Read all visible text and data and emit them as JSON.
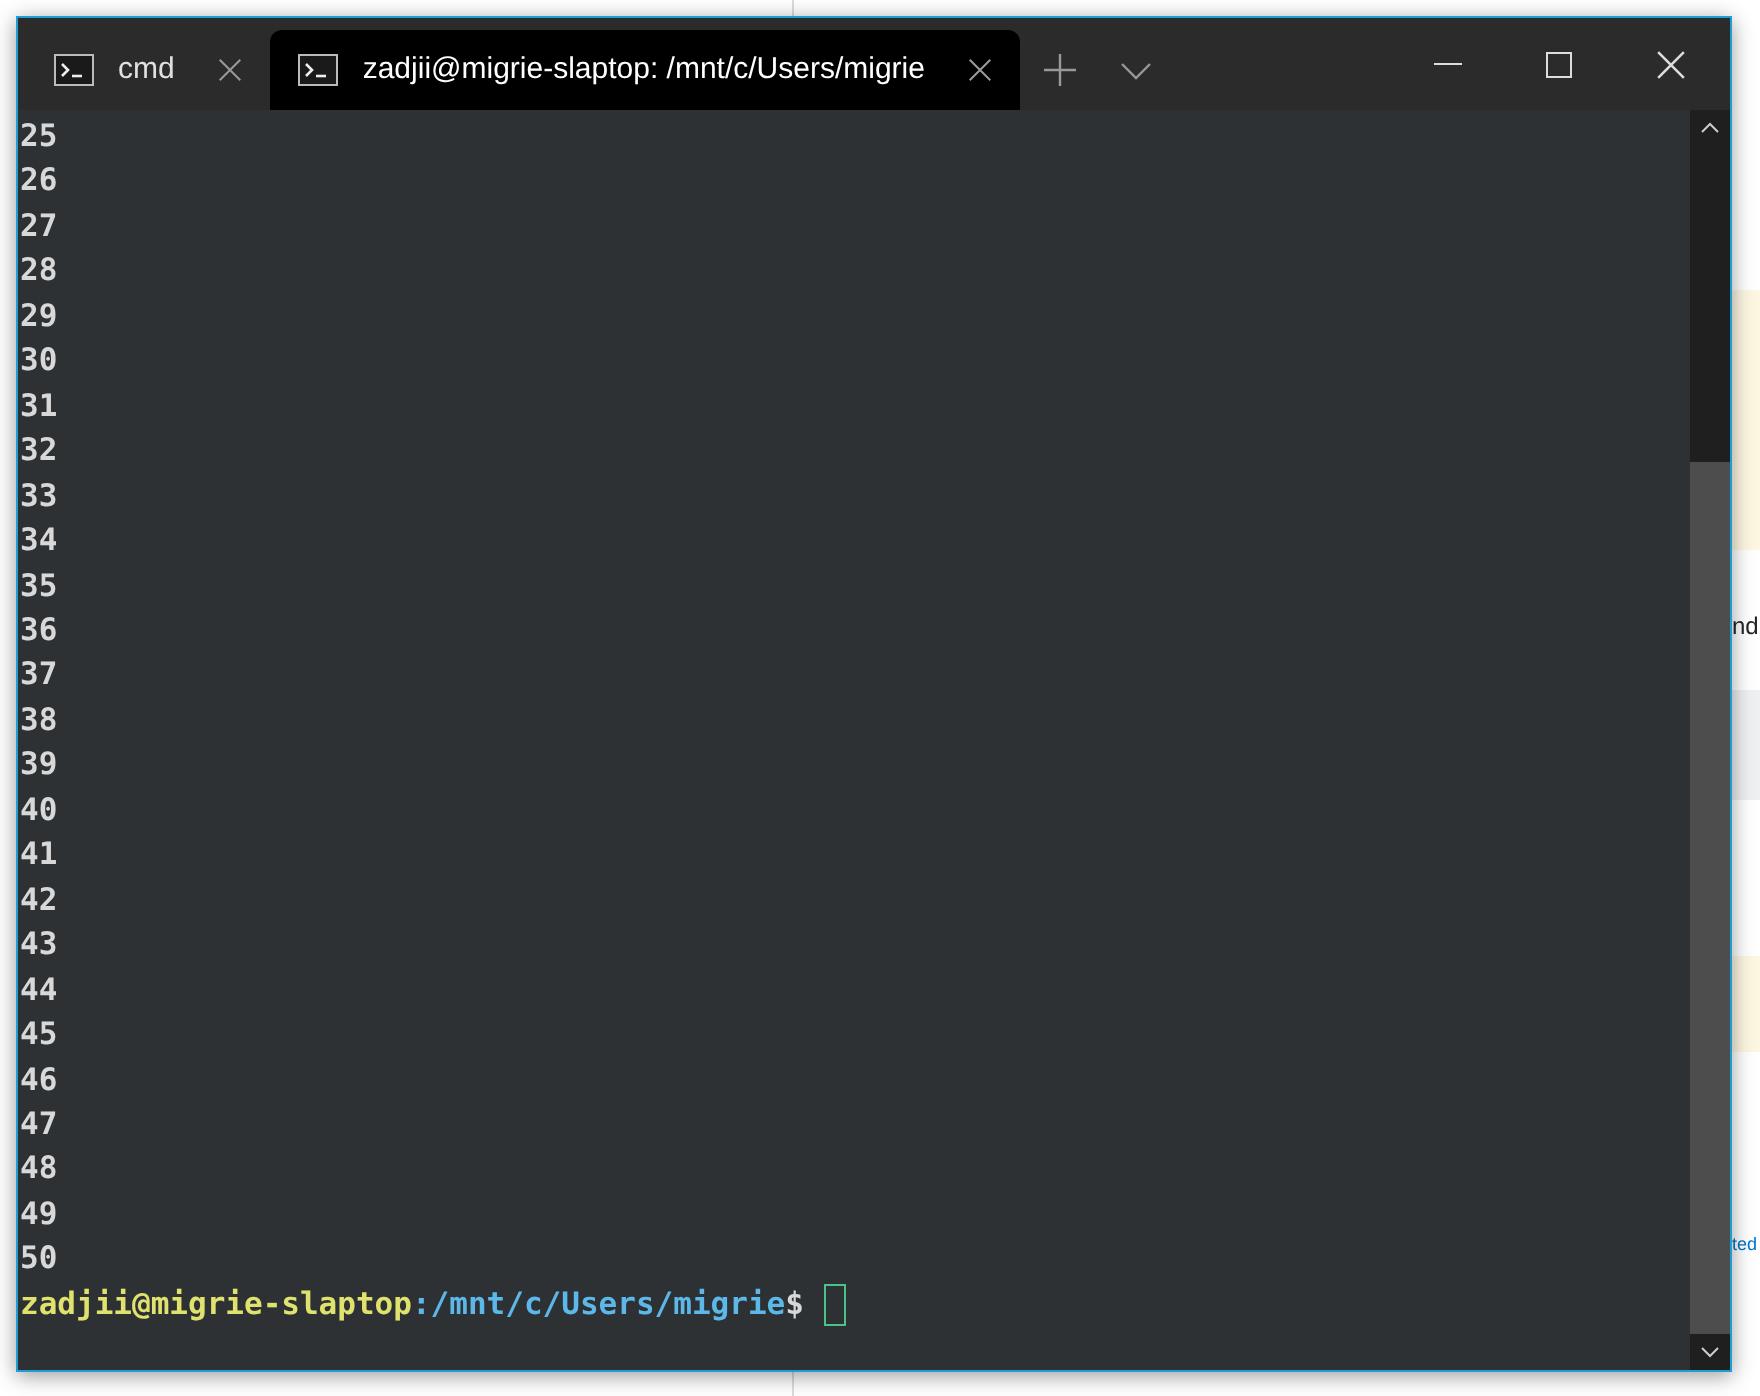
{
  "background_page": {
    "side_texts": [
      "nd",
      "ted"
    ]
  },
  "window": {
    "tabs": [
      {
        "title": "cmd",
        "selected": false
      },
      {
        "title": "zadjii@migrie-slaptop: /mnt/c/Users/migrie",
        "selected": true
      }
    ]
  },
  "terminal": {
    "lines": [
      "25",
      "26",
      "27",
      "28",
      "29",
      "30",
      "31",
      "32",
      "33",
      "34",
      "35",
      "36",
      "37",
      "38",
      "39",
      "40",
      "41",
      "42",
      "43",
      "44",
      "45",
      "46",
      "47",
      "48",
      "49",
      "50"
    ],
    "prompt": {
      "user_host": "zadjii@migrie-slaptop",
      "path": ":/mnt/c/Users/migrie",
      "symbol": "$"
    }
  }
}
